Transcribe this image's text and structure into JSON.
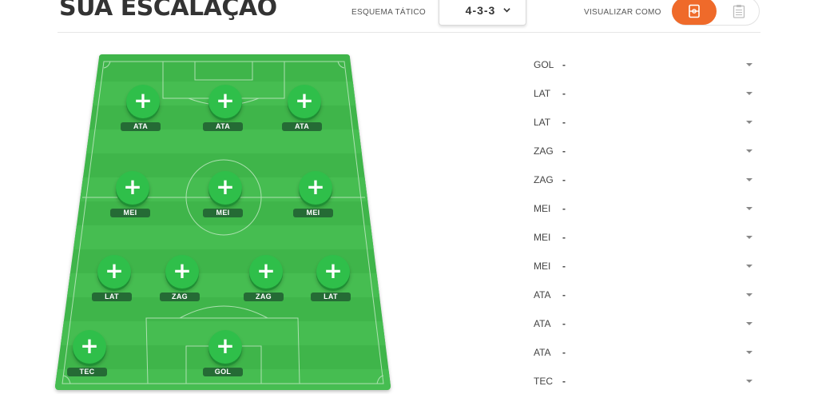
{
  "header": {
    "title": "SUA ESCALAÇÃO",
    "scheme_label": "ESQUEMA TÁTICO",
    "scheme_value": "4-3-3",
    "view_label": "VISUALIZAR COMO",
    "accent_color": "#ef6a2a"
  },
  "field": {
    "color": "#3fb54a",
    "plus_symbol": "+",
    "slots": [
      {
        "label": "ATA"
      },
      {
        "label": "ATA"
      },
      {
        "label": "ATA"
      },
      {
        "label": "MEI"
      },
      {
        "label": "MEI"
      },
      {
        "label": "MEI"
      },
      {
        "label": "LAT"
      },
      {
        "label": "ZAG"
      },
      {
        "label": "ZAG"
      },
      {
        "label": "LAT"
      },
      {
        "label": "TEC"
      },
      {
        "label": "GOL"
      }
    ]
  },
  "list": {
    "dash": "-",
    "rows": [
      {
        "pos": "GOL"
      },
      {
        "pos": "LAT"
      },
      {
        "pos": "LAT"
      },
      {
        "pos": "ZAG"
      },
      {
        "pos": "ZAG"
      },
      {
        "pos": "MEI"
      },
      {
        "pos": "MEI"
      },
      {
        "pos": "MEI"
      },
      {
        "pos": "ATA"
      },
      {
        "pos": "ATA"
      },
      {
        "pos": "ATA"
      },
      {
        "pos": "TEC"
      }
    ]
  },
  "icons": {
    "field_view": "field-view-icon",
    "list_view": "clipboard-icon",
    "scheme_dropdown": "chevron-down-icon",
    "row_dropdown": "caret-down-icon",
    "add_player": "plus-icon"
  }
}
